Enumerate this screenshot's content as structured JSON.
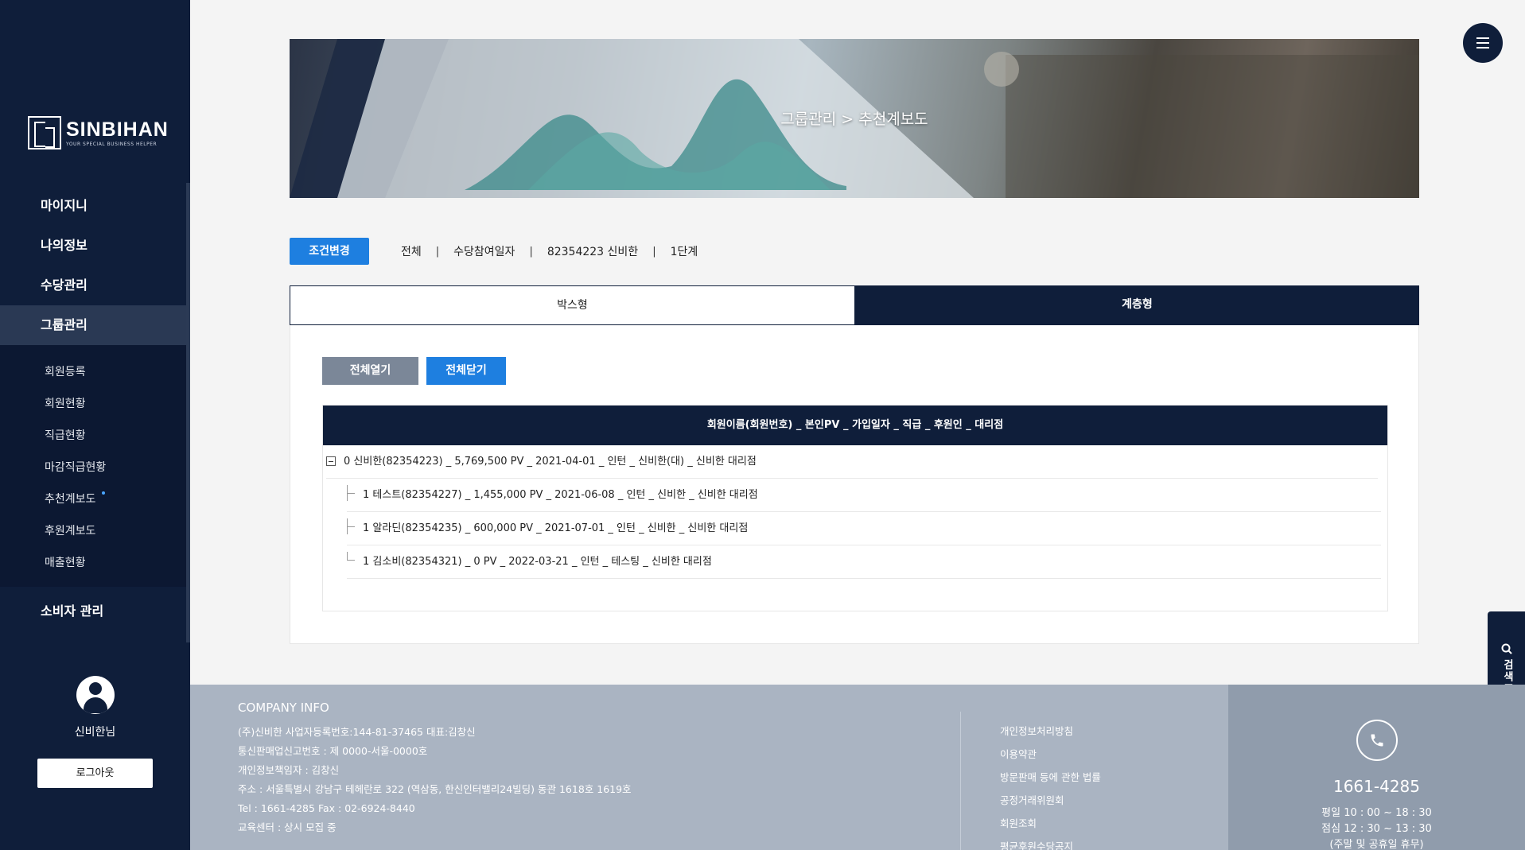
{
  "brand": {
    "name": "SINBIHAN",
    "tagline": "YOUR SPECIAL BUSINESS HELPER"
  },
  "sidebar": {
    "items": [
      {
        "label": "마이지니"
      },
      {
        "label": "나의정보"
      },
      {
        "label": "수당관리"
      },
      {
        "label": "그룹관리"
      }
    ],
    "sub_items": [
      {
        "label": "회원등록"
      },
      {
        "label": "회원현황"
      },
      {
        "label": "직급현황"
      },
      {
        "label": "마감직급현황"
      },
      {
        "label": "추천계보도"
      },
      {
        "label": "후원계보도"
      },
      {
        "label": "매출현황"
      }
    ],
    "consumer": "소비자 관리",
    "user_name": "신비한님",
    "logout": "로그아웃"
  },
  "banner": {
    "title": "그룹관리  >  추천계보도"
  },
  "filter": {
    "button": "조건변경",
    "items": [
      "전체",
      "수당참여일자",
      "82354223 신비한",
      "1단계"
    ],
    "separator": "|"
  },
  "tabs": [
    {
      "label": "박스형"
    },
    {
      "label": "계층형"
    }
  ],
  "panel": {
    "open_all": "전체열기",
    "close_all": "전체닫기",
    "header": "회원이름(회원번호) _ 본인PV _ 가입일자 _ 직급 _ 후원인 _ 대리점",
    "rows": [
      {
        "text": "0 신비한(82354223) _ 5,769,500 PV _ 2021-04-01 _ 인턴 _ 신비한(대) _ 신비한 대리점"
      },
      {
        "text": "1 테스트(82354227) _ 1,455,000 PV _ 2021-06-08 _ 인턴 _ 신비한 _ 신비한 대리점"
      },
      {
        "text": "1 알라딘(82354235) _ 600,000 PV _ 2021-07-01 _ 인턴 _ 신비한 _ 신비한 대리점"
      },
      {
        "text": "1 김소비(82354321) _ 0 PV _ 2022-03-21 _ 인턴 _ 테스팅 _ 신비한 대리점"
      }
    ]
  },
  "search_tab": "검색조건",
  "footer": {
    "title": "COMPANY INFO",
    "lines": [
      "(주)신비한     사업자등록번호:144-81-37465     대표:김창신",
      "통신판매업신고번호 : 제 0000-서울-0000호",
      "개인정보책임자 : 김창신",
      "주소 : 서울특별시 강남구 테헤란로 322 (역삼동, 한신인터밸리24빌딩) 동관 1618호 1619호",
      "Tel : 1661-4285     Fax : 02-6924-8440",
      "교육센터 : 상시 모집 중"
    ],
    "links": [
      "개인정보처리방침",
      "이용약관",
      "방문판매 등에 관한 법률",
      "공정거래위원회",
      "회원조회",
      "평균후원수당공지"
    ],
    "cs_number": "1661-4285",
    "cs_hours": [
      "평일 10 : 00 ~ 18 : 30",
      "점심 12 : 30 ~ 13 : 30",
      "(주말 및 공휴일 휴무)"
    ]
  },
  "colors": {
    "navy": "#0f1e3a",
    "accent": "#1e7fe0",
    "footer": "#aab4c2"
  }
}
